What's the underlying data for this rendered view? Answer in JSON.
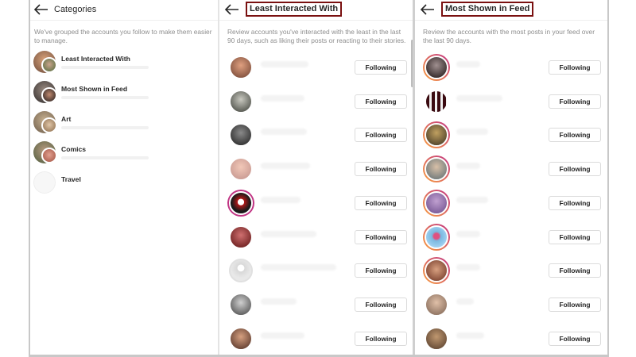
{
  "categories_panel": {
    "title": "Categories",
    "description": "We've grouped the accounts you follow to make them easier to manage.",
    "items": [
      {
        "label": "Least Interacted With"
      },
      {
        "label": "Most Shown in Feed"
      },
      {
        "label": "Art"
      },
      {
        "label": "Comics"
      },
      {
        "label": "Travel"
      }
    ]
  },
  "least_panel": {
    "title": "Least Interacted With",
    "description": "Review accounts you've interacted with the least in the last 90 days, such as liking their posts or reacting to their stories.",
    "button_label": "Following",
    "rows": 9
  },
  "most_panel": {
    "title": "Most Shown in Feed",
    "description": "Review the accounts with the most posts in your feed over the last 90 days.",
    "button_label": "Following",
    "rows": 9
  },
  "colors": {
    "highlight_box": "#7a1010",
    "story_ring": "#c13584",
    "text_primary": "#262626",
    "text_secondary": "#8e8e8e"
  }
}
